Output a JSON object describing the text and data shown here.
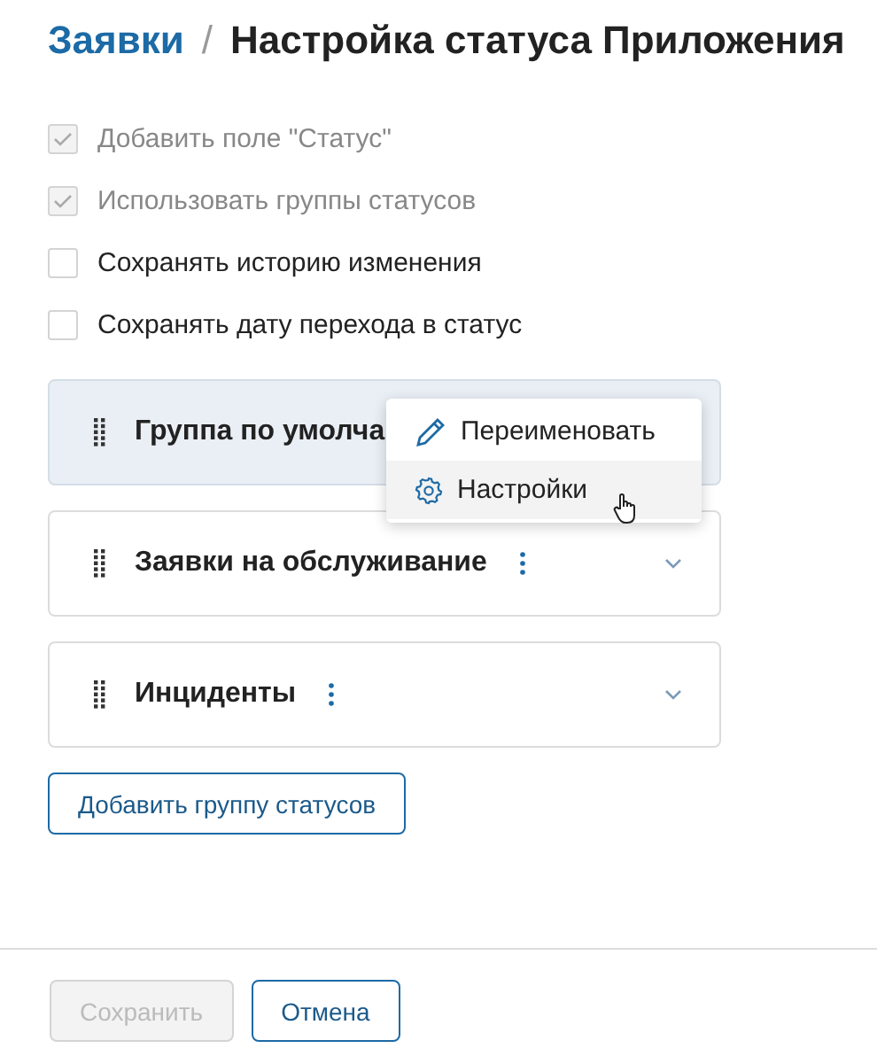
{
  "breadcrumb": {
    "parent": "Заявки",
    "separator": "/",
    "title": "Настройка статуса Приложения"
  },
  "options": [
    {
      "label": "Добавить поле \"Статус\"",
      "checked": true,
      "disabled": true
    },
    {
      "label": "Использовать группы статусов",
      "checked": true,
      "disabled": true
    },
    {
      "label": "Сохранять историю изменения",
      "checked": false,
      "disabled": false
    },
    {
      "label": "Сохранять дату перехода в статус",
      "checked": false,
      "disabled": false
    }
  ],
  "groups": [
    {
      "name": "Группа по умолча",
      "selected": true,
      "menu_open": true
    },
    {
      "name": "Заявки на обслуживание",
      "selected": false,
      "menu_open": false
    },
    {
      "name": "Инциденты",
      "selected": false,
      "menu_open": false
    }
  ],
  "context_menu": [
    {
      "label": "Переименовать",
      "kind": "rename",
      "selected": false
    },
    {
      "label": "Настройки",
      "kind": "settings",
      "selected": true
    }
  ],
  "add_group_button": "Добавить группу статусов",
  "footer": {
    "save": {
      "label": "Сохранить",
      "disabled": true
    },
    "cancel": {
      "label": "Отмена"
    }
  }
}
